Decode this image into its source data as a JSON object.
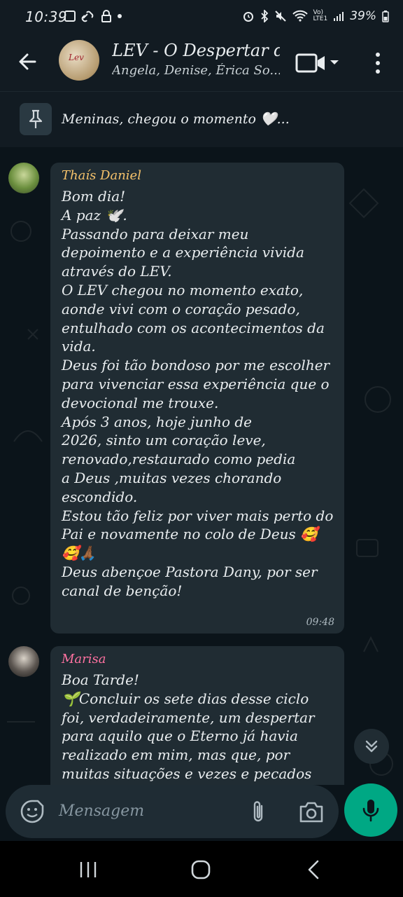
{
  "status_bar": {
    "time": "10:39",
    "battery": "39%"
  },
  "header": {
    "title": "LEV - O Despertar d...",
    "subtitle": "Angela, Denise, Érica So...",
    "avatar_text": "Lev"
  },
  "pinned": {
    "text": "Meninas, chegou o momento 🤍..."
  },
  "messages": [
    {
      "sender": "Thaís Daniel",
      "sender_color": "#f5c26b",
      "lines": [
        "Bom dia!",
        "A paz 🕊️.",
        "Passando para deixar meu",
        "depoimento e a experiência vivida",
        "através do LEV.",
        "O LEV chegou no momento exato,",
        "aonde  vivi com o coração pesado,",
        "entulhado com os acontecimentos da",
        "vida.",
        "Deus foi tão bondoso por me escolher",
        "para vivenciar essa experiência que o",
        "devocional me trouxe.",
        "Após 3 anos, hoje junho de",
        "2026, sinto um coração leve,",
        "renovado,restaurado como pedia",
        "a Deus ,muitas vezes chorando",
        "escondido.",
        "Estou tão feliz por viver mais perto do",
        "Pai e novamente no colo de Deus 🥰",
        "🥰🙏🏾",
        "Deus abençoe Pastora Dany, por ser",
        "canal de benção!"
      ],
      "time": "09:48"
    },
    {
      "sender": "Marisa",
      "sender_color": "#ff72a1",
      "lines": [
        "Boa Tarde!",
        "🌱Concluir os sete dias desse ciclo",
        "foi, verdadeiramente, um despertar",
        "para aquilo que o Eterno já havia",
        "realizado em mim, mas que, por",
        "muitas situações e vezes e pecados"
      ],
      "time": ""
    }
  ],
  "input": {
    "placeholder": "Mensagem"
  },
  "colors": {
    "accent": "#00a884",
    "bubble": "#202c33",
    "background": "#0b141a"
  },
  "icons": [
    "back-arrow-icon",
    "video-call-icon",
    "dropdown-icon",
    "more-options-icon",
    "pin-icon",
    "emoji-sticker-icon",
    "attach-icon",
    "camera-icon",
    "mic-icon",
    "scroll-down-icon",
    "recents-icon",
    "home-icon",
    "back-nav-icon"
  ]
}
